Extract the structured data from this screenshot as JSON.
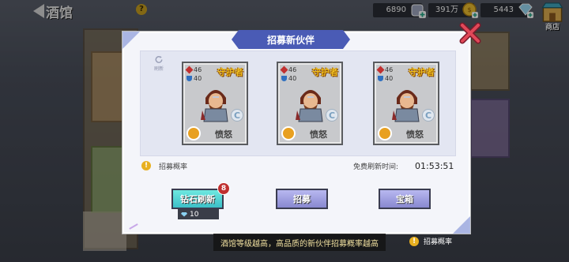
{
  "header": {
    "back_title": "酒馆",
    "help": "?",
    "resources": [
      {
        "value": "6890",
        "icon": "energy-plus-icon"
      },
      {
        "value": "391万",
        "icon": "gold-coin-icon"
      },
      {
        "value": "5443",
        "icon": "diamond-icon"
      }
    ],
    "shop_label": "商店"
  },
  "modal": {
    "title": "招募新伙伴",
    "refresh_label": "刷新",
    "heroes": [
      {
        "attack": "46",
        "defense": "40",
        "role": "守护者",
        "skill": "愤怒"
      },
      {
        "attack": "46",
        "defense": "40",
        "role": "守护者",
        "skill": "愤怒"
      },
      {
        "attack": "46",
        "defense": "40",
        "role": "守护者",
        "skill": "愤怒"
      }
    ],
    "prob_label": "招募概率",
    "free_refresh_label": "免费刷新时间:",
    "timer": "01:53:51",
    "buttons": {
      "diamond_refresh": "钻石刷新",
      "diamond_badge": "8",
      "recruit": "招募",
      "reward": "宝箱"
    },
    "cost": "10"
  },
  "footer": {
    "tip": "酒馆等级越高，高品质的新伙伴招募概率越高",
    "prob_label": "招募概率"
  }
}
